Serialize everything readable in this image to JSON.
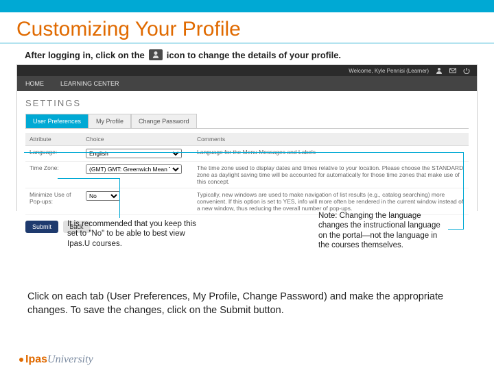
{
  "title": "Customizing Your Profile",
  "intro_before": "After logging in, click on the",
  "intro_after": "icon to change the details of your profile.",
  "screenshot": {
    "welcome": "Welcome, Kyle Pennisi (Learner)",
    "mainnav": [
      "HOME",
      "LEARNING CENTER"
    ],
    "heading": "SETTINGS",
    "tabs": [
      "User Preferences",
      "My Profile",
      "Change Password"
    ],
    "columns": [
      "Attribute",
      "Choice",
      "Comments"
    ],
    "rows": [
      {
        "attr": "Language:",
        "choice": "English",
        "comment": "Language for the Menu Messages and Labels"
      },
      {
        "attr": "Time Zone:",
        "choice": "(GMT) GMT: Greenwich Mean Time",
        "comment": "The time zone used to display dates and times relative to your location. Please choose the STANDARD zone as daylight saving time will be accounted for automatically for those time zones that make use of this concept."
      },
      {
        "attr": "Minimize Use of Pop-ups:",
        "choice": "No",
        "comment": "Typically, new windows are used to make navigation of list results (e.g., catalog searching) more convenient. If this option is set to YES, info will more often be rendered in the current window instead of a new window, thus reducing the overall number of pop-ups."
      }
    ],
    "buttons": {
      "submit": "Submit",
      "back": "Back"
    }
  },
  "callout_left": "It is recommended that you keep this set to \"No\" to be able to best view Ipas.U courses.",
  "callout_right": "Note: Changing the language changes the instructional language on the portal—not the language in the courses themselves.",
  "bodytext": "Click on each tab (User Preferences, My Profile, Change Password) and make the appropriate changes. To save the changes, click on the Submit button.",
  "brand": {
    "ipas": "Ipas",
    "uni": "University"
  }
}
